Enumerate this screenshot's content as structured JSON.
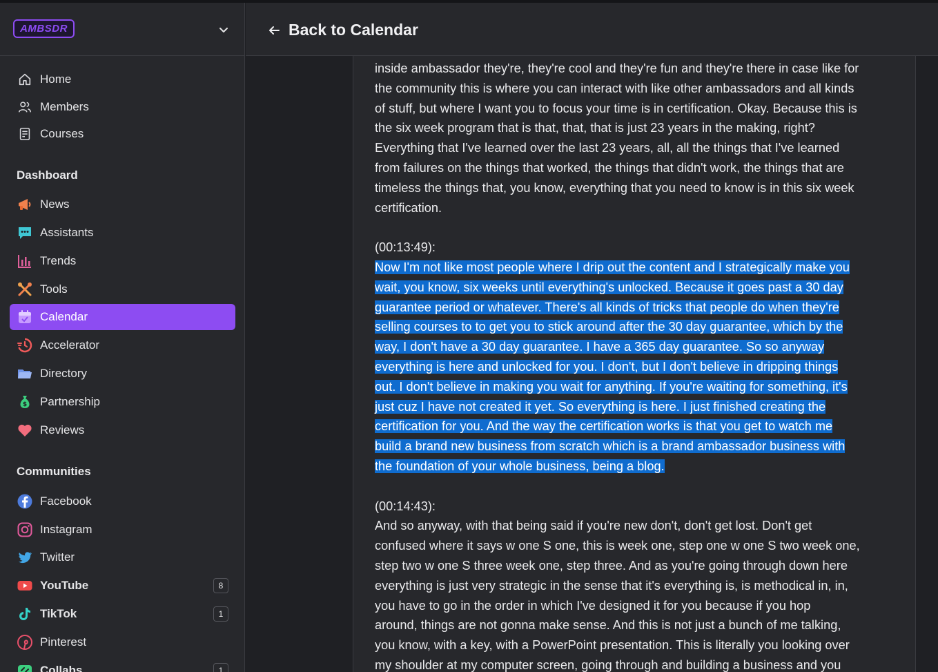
{
  "app": {
    "logo_text": "AMBSDR"
  },
  "header": {
    "back_label": "Back to Calendar"
  },
  "sidebar": {
    "primary": [
      {
        "label": "Home",
        "icon": "home-icon"
      },
      {
        "label": "Members",
        "icon": "members-icon"
      },
      {
        "label": "Courses",
        "icon": "courses-icon"
      }
    ],
    "dashboard_title": "Dashboard",
    "dashboard": [
      {
        "label": "News",
        "icon": "megaphone-icon"
      },
      {
        "label": "Assistants",
        "icon": "chat-bubble-icon"
      },
      {
        "label": "Trends",
        "icon": "bar-chart-icon"
      },
      {
        "label": "Tools",
        "icon": "tools-icon"
      },
      {
        "label": "Calendar",
        "icon": "calendar-icon",
        "active": true
      },
      {
        "label": "Accelerator",
        "icon": "accelerator-icon"
      },
      {
        "label": "Directory",
        "icon": "folder-icon"
      },
      {
        "label": "Partnership",
        "icon": "money-bag-icon"
      },
      {
        "label": "Reviews",
        "icon": "heart-icon"
      }
    ],
    "communities_title": "Communities",
    "communities": [
      {
        "label": "Facebook",
        "icon": "facebook-icon"
      },
      {
        "label": "Instagram",
        "icon": "instagram-icon"
      },
      {
        "label": "Twitter",
        "icon": "twitter-icon"
      },
      {
        "label": "YouTube",
        "icon": "youtube-icon",
        "badge": "8"
      },
      {
        "label": "TikTok",
        "icon": "tiktok-icon",
        "badge": "1"
      },
      {
        "label": "Pinterest",
        "icon": "pinterest-icon"
      },
      {
        "label": "Collabs",
        "icon": "collabs-icon",
        "badge": "1"
      }
    ]
  },
  "colors": {
    "accent": "#8d4cf2",
    "selection": "#0f6ccf",
    "background": "#1f2024",
    "panel": "#27282c"
  },
  "transcript": {
    "intro_lines": [
      "inside ambassador they're, they're cool and they're fun and they're there in case like for",
      "the community this is where you can interact with like other ambassadors and all kinds",
      "of stuff, but where I want you to focus your time is in certification. Okay. Because this is",
      "the six week program that is that, that, that is just 23 years in the making, right?",
      "Everything that I've learned over the last 23 years, all, all the things that I've learned",
      "from failures on the things that worked, the things that didn't work, the things that are",
      "timeless the things that, you know, everything that you need to know is in this six week",
      "certification."
    ],
    "t1": "(00:13:49):",
    "highlight_lines": [
      "Now I'm not like most people where I drip out the content and I strategically make you",
      "wait, you know, six weeks until everything's unlocked. Because it goes past a 30 day",
      "guarantee period or whatever. There's all kinds of tricks that people do when they're",
      "selling courses to to get you to stick around after the 30 day guarantee, which by the",
      "way, I don't have a 30 day guarantee. I have a 365 day guarantee. So so anyway",
      "everything is here and unlocked for you. I don't, but I don't believe in dripping things",
      "out. I don't believe in making you wait for anything. If you're waiting for something, it's",
      "just cuz I have not created it yet. So everything is here. I just finished creating the",
      "certification for you. And the way the certification works is that you get to watch me",
      "build a brand new business from scratch which is a brand ambassador business with",
      "the foundation of your whole business, being a blog."
    ],
    "t2": "(00:14:43):",
    "outro_lines": [
      "And so anyway, with that being said if you're new don't, don't get lost. Don't get",
      "confused where it says w one S one, this is week one, step one w one S two week one,",
      "step two w one S three week one, step three. And as you're going through down here",
      "everything is just very strategic in the sense that it's everything is, is methodical in, in,",
      "you have to go in the order in which I've designed it for you because if you hop",
      "around, things are not gonna make sense. And this is not just a bunch of me talking,",
      "you know, with a key, with a PowerPoint presentation. This is literally you looking over",
      "my shoulder at my computer screen, going through and building a business and you"
    ]
  }
}
